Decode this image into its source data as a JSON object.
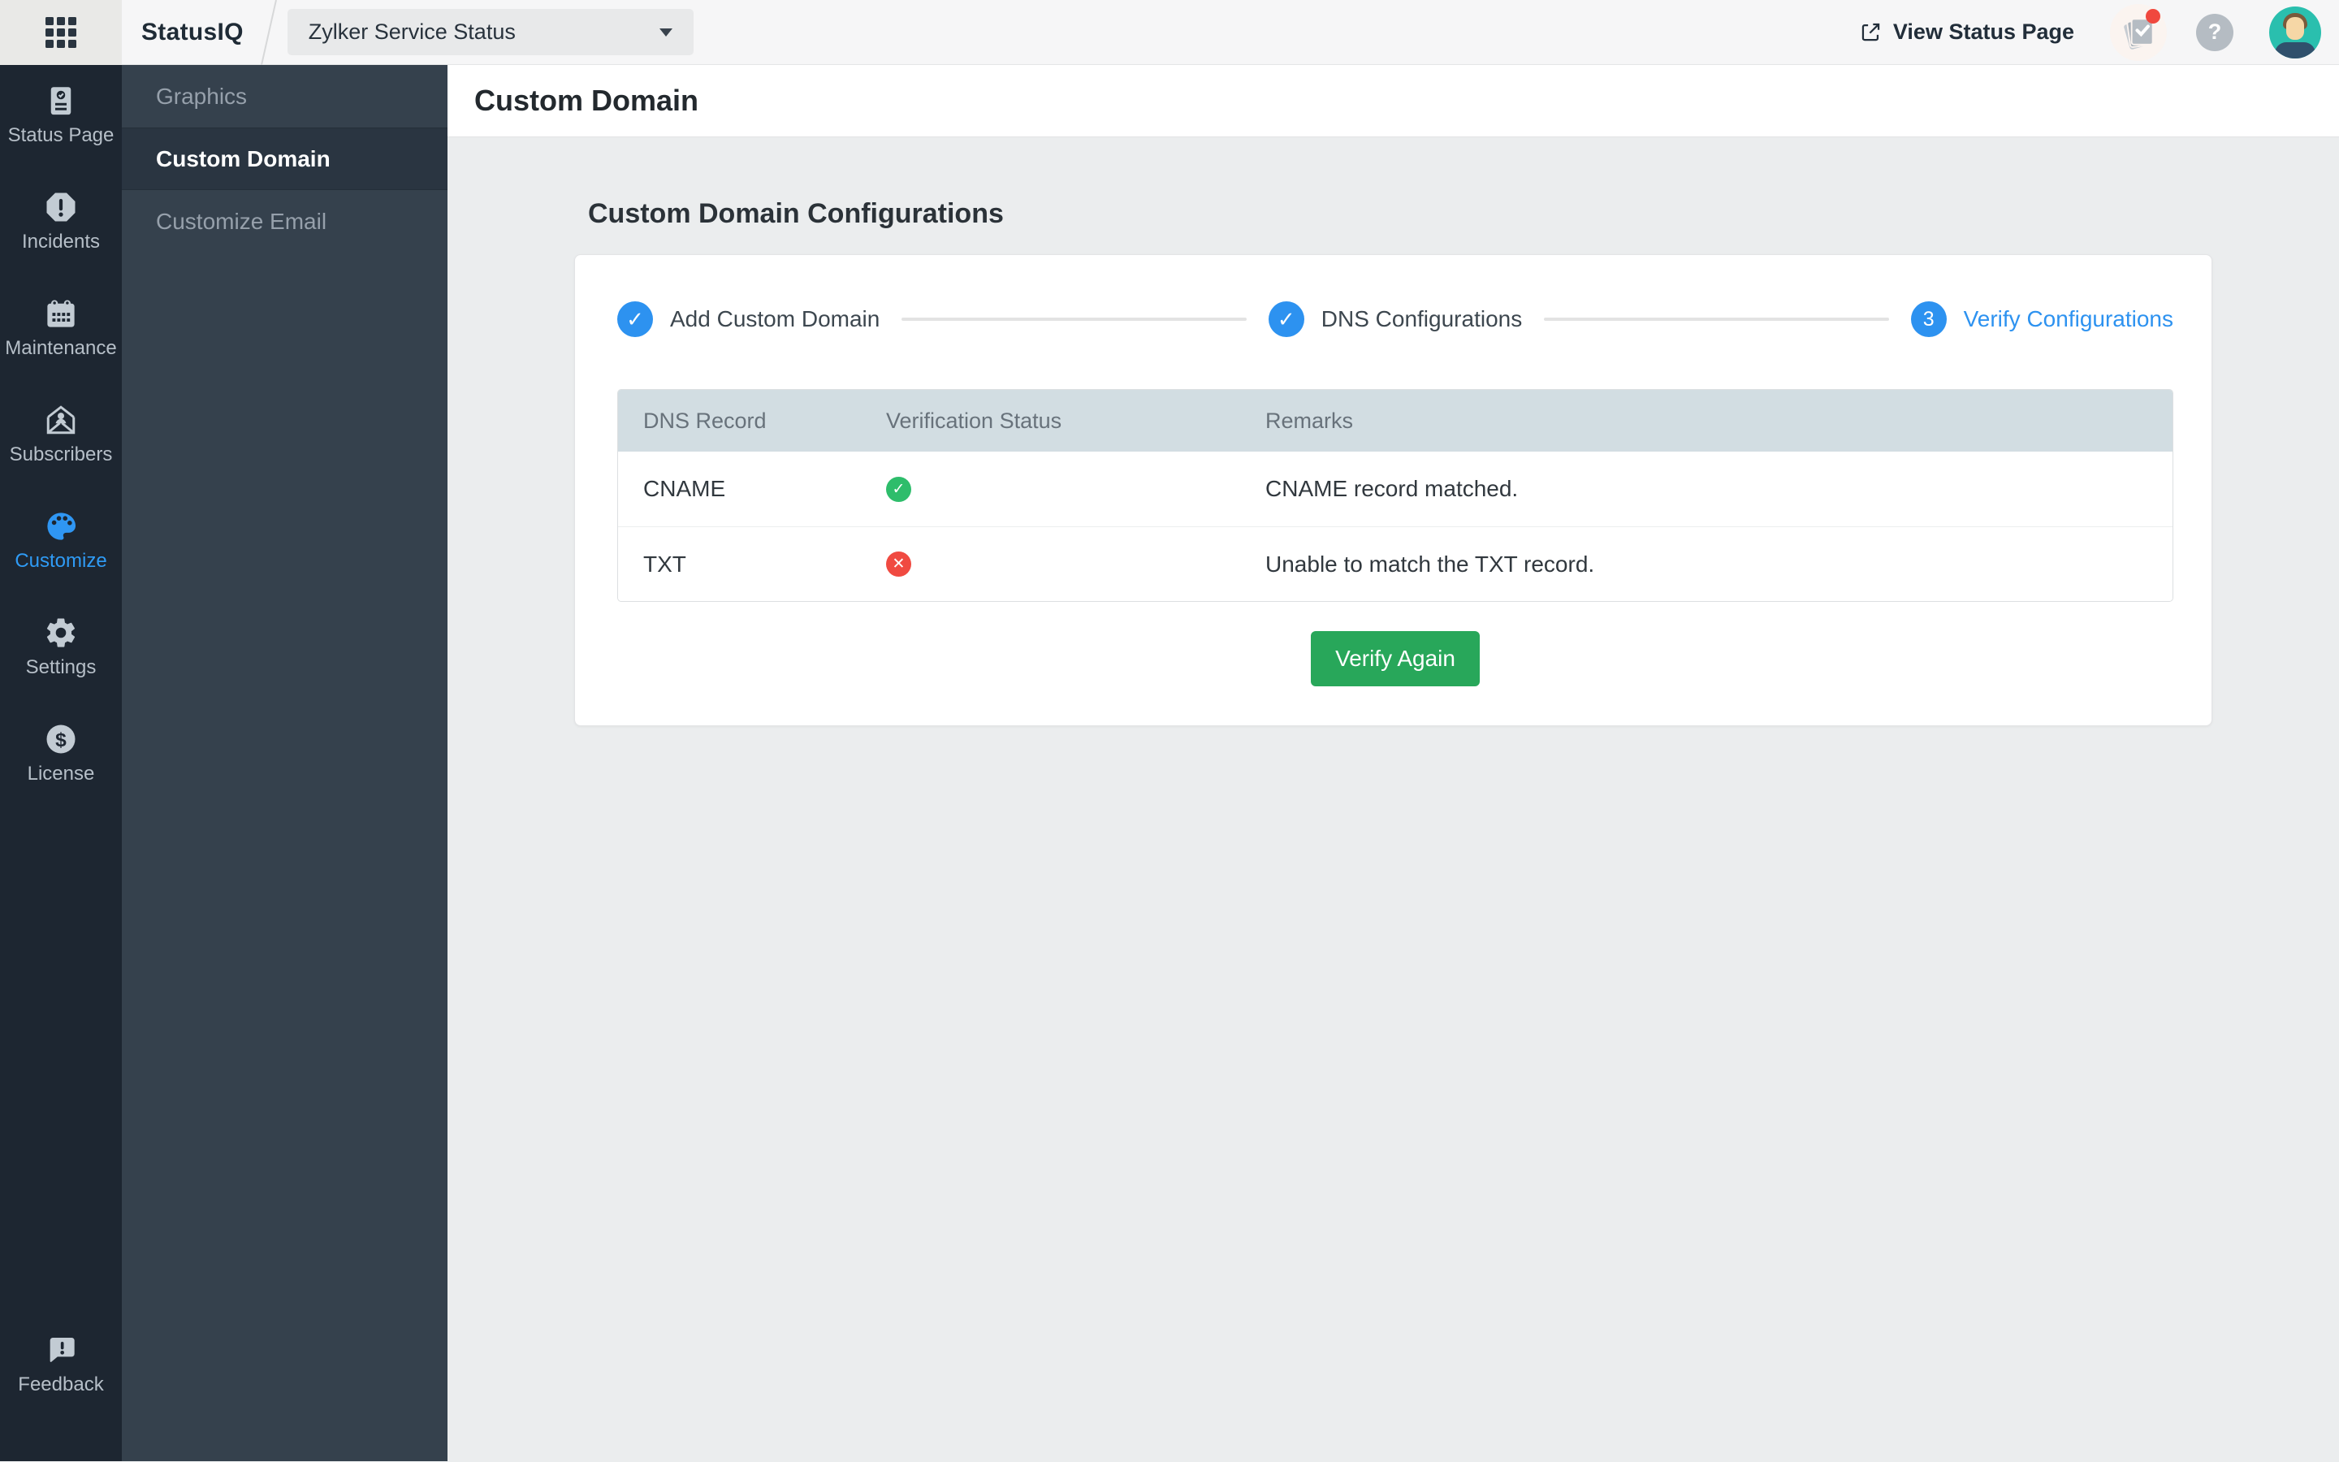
{
  "topbar": {
    "brand": "StatusIQ",
    "portal_selector": {
      "value": "Zylker Service Status"
    },
    "view_status_page_label": "View Status Page",
    "help_glyph": "?",
    "icons": [
      "app-grid-icon",
      "external-link-icon",
      "notifications-icon",
      "help-icon",
      "avatar"
    ]
  },
  "sidebar": {
    "active": "Customize",
    "items": [
      {
        "label": "Status Page",
        "icon": "status-page-icon"
      },
      {
        "label": "Incidents",
        "icon": "incidents-icon"
      },
      {
        "label": "Maintenance",
        "icon": "maintenance-calendar-icon"
      },
      {
        "label": "Subscribers",
        "icon": "subscribers-envelope-icon"
      },
      {
        "label": "Customize",
        "icon": "customize-palette-icon"
      },
      {
        "label": "Settings",
        "icon": "settings-gear-icon"
      },
      {
        "label": "License",
        "icon": "license-dollar-icon"
      },
      {
        "label": "Feedback",
        "icon": "feedback-bubble-icon"
      }
    ]
  },
  "subnav": {
    "active": "Custom Domain",
    "items": [
      {
        "label": "Graphics"
      },
      {
        "label": "Custom Domain"
      },
      {
        "label": "Customize Email"
      }
    ]
  },
  "page": {
    "title": "Custom Domain",
    "heading": "Custom Domain Configurations"
  },
  "stepper": {
    "steps": [
      {
        "label": "Add Custom Domain",
        "state": "done",
        "glyph": "✓"
      },
      {
        "label": "DNS Configurations",
        "state": "done",
        "glyph": "✓"
      },
      {
        "label": "Verify Configurations",
        "state": "active",
        "number": "3"
      }
    ]
  },
  "table": {
    "columns": [
      "DNS Record",
      "Verification Status",
      "Remarks"
    ],
    "rows": [
      {
        "record": "CNAME",
        "status": "success",
        "status_glyph": "✓",
        "remark": "CNAME record matched."
      },
      {
        "record": "TXT",
        "status": "error",
        "status_glyph": "✕",
        "remark": "Unable to match the TXT record."
      }
    ]
  },
  "actions": {
    "verify_again_label": "Verify Again"
  },
  "colors": {
    "accent_blue": "#2D92F0",
    "success_green": "#2EBD6B",
    "error_red": "#F04A41",
    "button_green": "#28A75A",
    "sidebar_rail": "#1D2631",
    "sidebar_panel": "#35414D",
    "table_header_bg": "#D2DDE2"
  }
}
